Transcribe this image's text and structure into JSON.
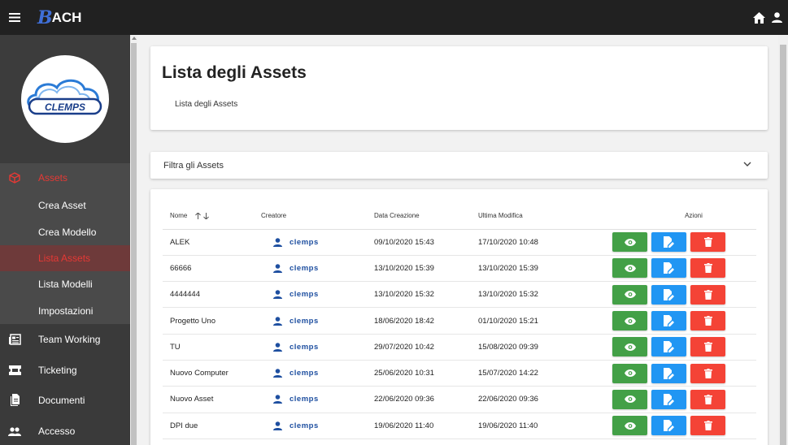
{
  "app": {
    "logo_text": "ACH",
    "logo_letter": "B"
  },
  "sidebar": {
    "brand_logo": "clemps-cloud-logo",
    "brand_text": "CLEMPS",
    "assets_section": {
      "label": "Assets",
      "children": [
        {
          "label": "Crea Asset"
        },
        {
          "label": "Crea Modello"
        },
        {
          "label": "Lista Assets"
        },
        {
          "label": "Lista Modelli"
        },
        {
          "label": "Impostazioni"
        }
      ]
    },
    "items": [
      {
        "label": "Team Working",
        "icon": "newspaper-icon"
      },
      {
        "label": "Ticketing",
        "icon": "ticket-icon"
      },
      {
        "label": "Documenti",
        "icon": "document-icon"
      },
      {
        "label": "Accesso",
        "icon": "people-icon"
      }
    ]
  },
  "page": {
    "title": "Lista degli Assets",
    "breadcrumb": "Lista degli Assets",
    "filter_label": "Filtra gli Assets"
  },
  "table": {
    "headers": {
      "name": "Nome",
      "creator": "Creatore",
      "created": "Data Creazione",
      "modified": "Ultima Modifica",
      "actions": "Azioni"
    },
    "rows": [
      {
        "name": "ALEK",
        "creator": "clemps",
        "created": "09/10/2020 15:43",
        "modified": "17/10/2020 10:48"
      },
      {
        "name": "66666",
        "creator": "clemps",
        "created": "13/10/2020 15:39",
        "modified": "13/10/2020 15:39"
      },
      {
        "name": "4444444",
        "creator": "clemps",
        "created": "13/10/2020 15:32",
        "modified": "13/10/2020 15:32"
      },
      {
        "name": "Progetto Uno",
        "creator": "clemps",
        "created": "18/06/2020 18:42",
        "modified": "01/10/2020 15:21"
      },
      {
        "name": "TU",
        "creator": "clemps",
        "created": "29/07/2020 10:42",
        "modified": "15/08/2020 09:39"
      },
      {
        "name": "Nuovo Computer",
        "creator": "clemps",
        "created": "25/06/2020 10:31",
        "modified": "15/07/2020 14:22"
      },
      {
        "name": "Nuovo Asset",
        "creator": "clemps",
        "created": "22/06/2020 09:36",
        "modified": "22/06/2020 09:36"
      },
      {
        "name": "DPI due",
        "creator": "clemps",
        "created": "19/06/2020 11:40",
        "modified": "19/06/2020 11:40"
      }
    ]
  },
  "colors": {
    "topbar": "#212121",
    "sidebar": "#3a3a3a",
    "active": "#e53935",
    "view_button": "#43a047",
    "edit_button": "#2196f3",
    "delete_button": "#f44336",
    "creator_link": "#1e4fa0"
  }
}
